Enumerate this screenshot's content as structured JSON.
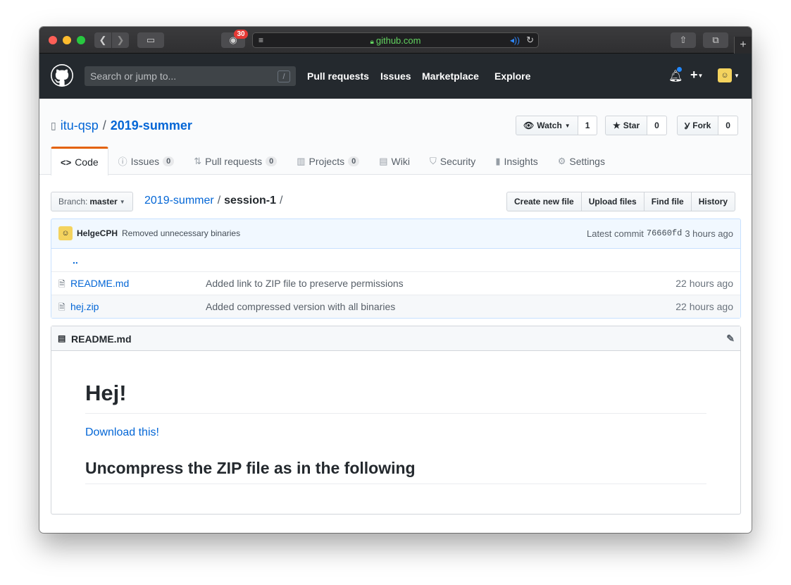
{
  "browser": {
    "url": "github.com",
    "extension_badge": "30"
  },
  "header": {
    "search_placeholder": "Search or jump to...",
    "search_key": "/",
    "nav": [
      "Pull requests",
      "Issues",
      "Marketplace",
      "Explore"
    ]
  },
  "repo": {
    "owner": "itu-qsp",
    "separator": "/",
    "name": "2019-summer",
    "watch_label": "Watch",
    "watch_count": "1",
    "star_label": "Star",
    "star_count": "0",
    "fork_label": "Fork",
    "fork_count": "0"
  },
  "tabs": [
    {
      "label": "Code",
      "icon": "code-icon"
    },
    {
      "label": "Issues",
      "count": "0",
      "icon": "issue-icon"
    },
    {
      "label": "Pull requests",
      "count": "0",
      "icon": "pull-request-icon"
    },
    {
      "label": "Projects",
      "count": "0",
      "icon": "project-icon"
    },
    {
      "label": "Wiki",
      "icon": "book-icon"
    },
    {
      "label": "Security",
      "icon": "shield-icon"
    },
    {
      "label": "Insights",
      "icon": "graph-icon"
    },
    {
      "label": "Settings",
      "icon": "gear-icon"
    }
  ],
  "filenav": {
    "branch_prefix": "Branch:",
    "branch": "master",
    "crumb_root": "2019-summer",
    "crumb_current": "session-1",
    "actions": [
      "Create new file",
      "Upload files",
      "Find file",
      "History"
    ]
  },
  "commit": {
    "author": "HelgeCPH",
    "message": "Removed unnecessary binaries",
    "label": "Latest commit",
    "sha": "76660fd",
    "age": "3 hours ago"
  },
  "files": [
    {
      "name": "README.md",
      "message": "Added link to ZIP file to preserve permissions",
      "age": "22 hours ago"
    },
    {
      "name": "hej.zip",
      "message": "Added compressed version with all binaries",
      "age": "22 hours ago"
    }
  ],
  "parent_dir": "..",
  "readme": {
    "title": "README.md",
    "h1": "Hej!",
    "link": "Download this!",
    "h2": "Uncompress the ZIP file as in the following"
  },
  "colors": {
    "header_bg": "#24292e",
    "link": "#0366d6",
    "tab_accent": "#e36209"
  }
}
